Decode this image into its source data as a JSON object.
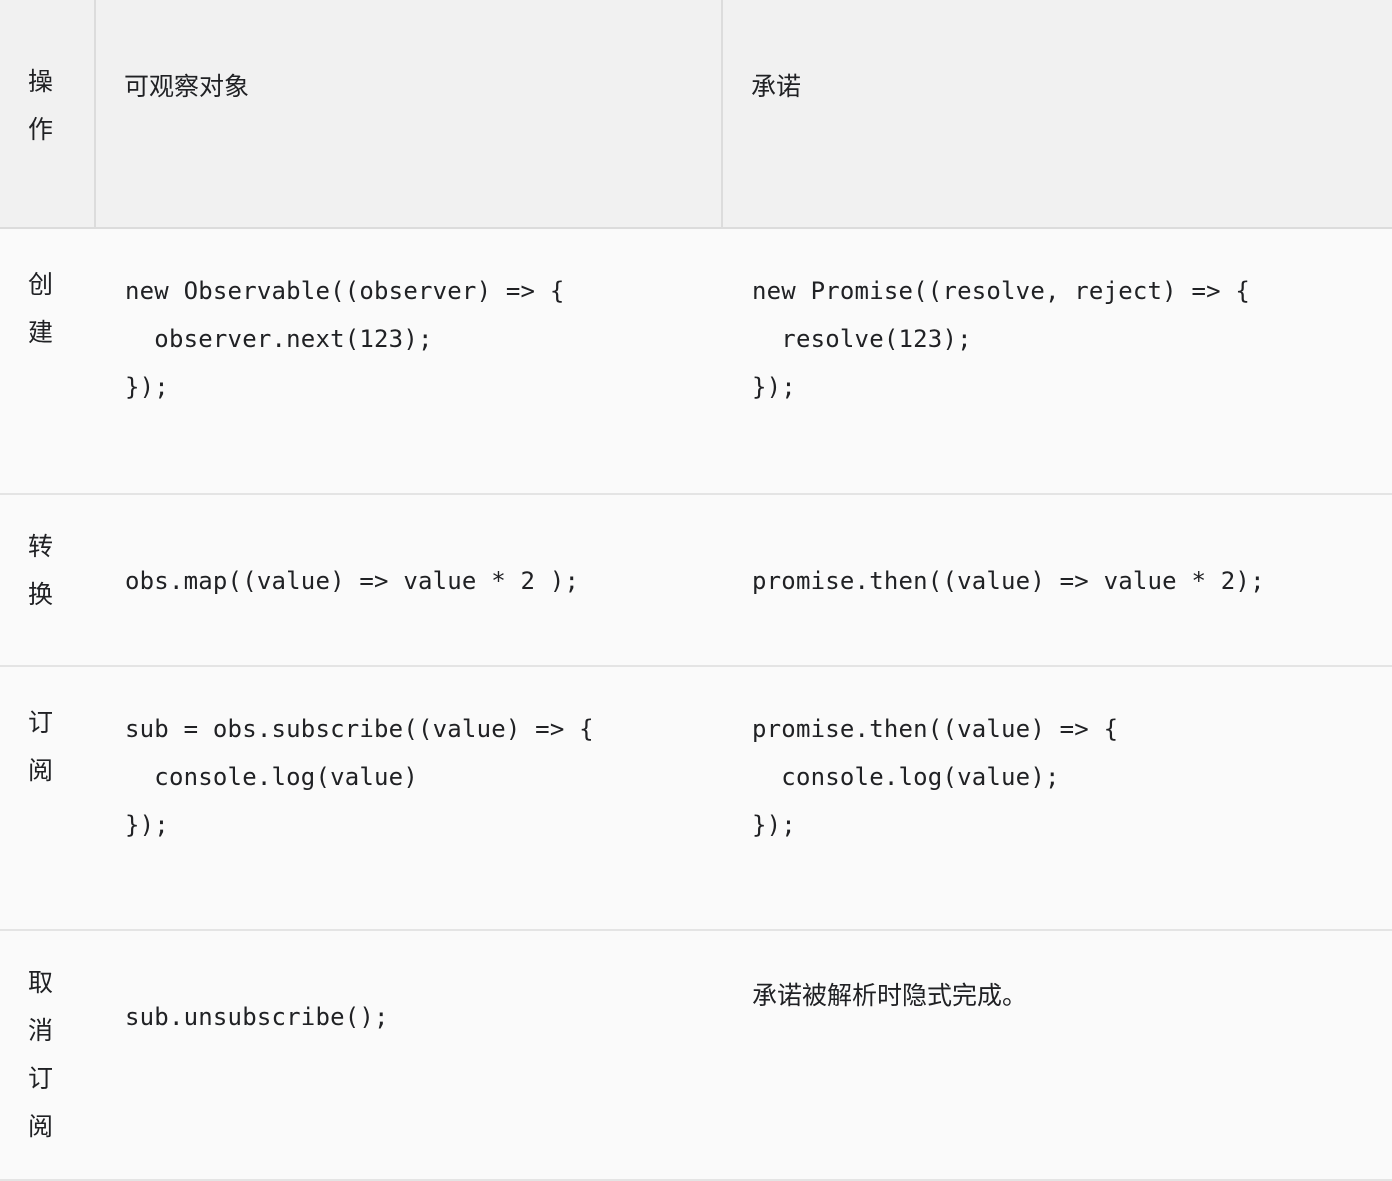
{
  "table": {
    "columns": [
      {
        "key": "operation",
        "label": "操作"
      },
      {
        "key": "observable",
        "label": "可观察对象"
      },
      {
        "key": "promise",
        "label": "承诺"
      }
    ],
    "rows": [
      {
        "operation": "创建",
        "observable": "new Observable((observer) => {\n  observer.next(123);\n});",
        "promise": "new Promise((resolve, reject) => {\n  resolve(123);\n});"
      },
      {
        "operation": "转换",
        "observable": "obs.map((value) => value * 2 );",
        "promise": "promise.then((value) => value * 2);"
      },
      {
        "operation": "订阅",
        "observable": "sub = obs.subscribe((value) => {\n  console.log(value)\n});",
        "promise": "promise.then((value) => {\n  console.log(value);\n});"
      },
      {
        "operation": "取消订阅",
        "observable": "sub.unsubscribe();",
        "promise": "承诺被解析时隐式完成。"
      }
    ]
  },
  "colors": {
    "header_background": "#f1f1f1",
    "row_background": "#fafafa",
    "border": "#dcdcdc",
    "row_border": "#e4e4e4",
    "text": "#202124"
  }
}
